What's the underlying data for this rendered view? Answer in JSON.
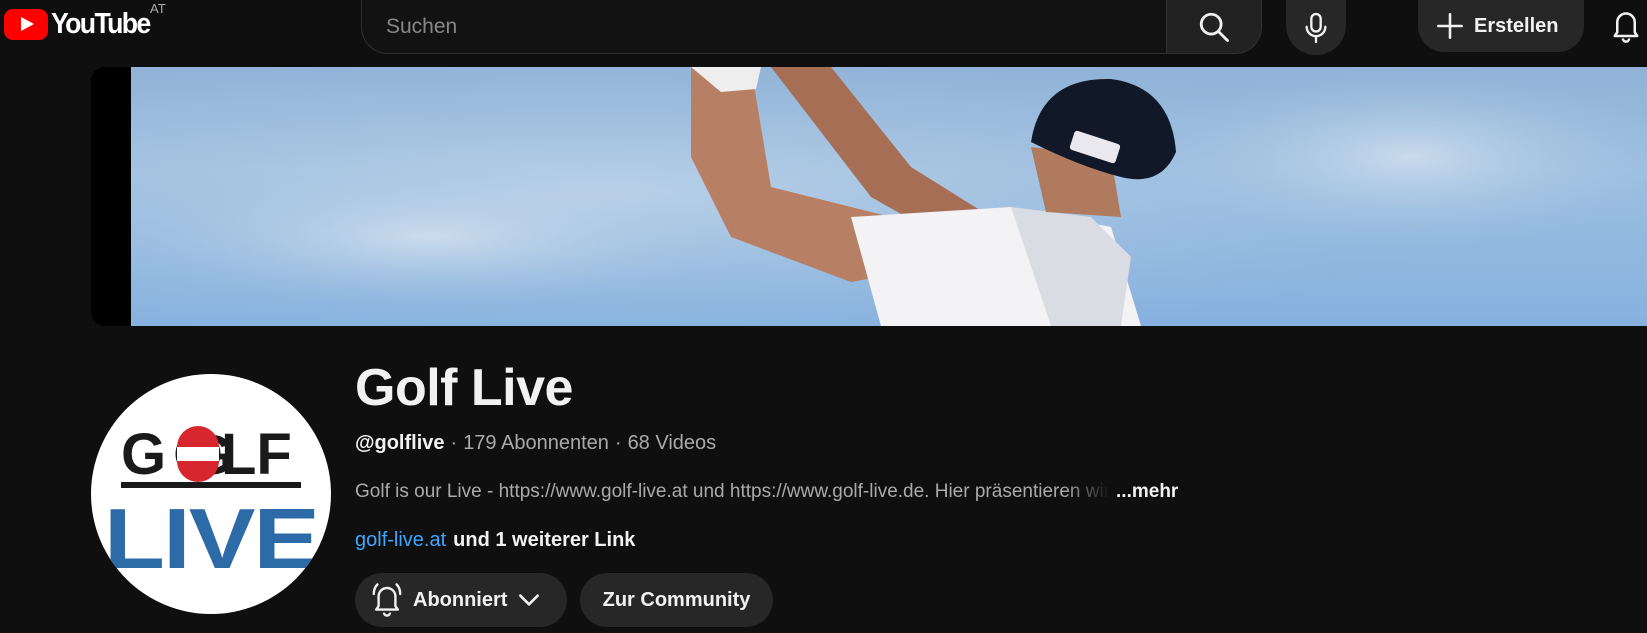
{
  "header": {
    "logo_text": "YouTube",
    "country_code": "AT",
    "search_placeholder": "Suchen",
    "create_label": "Erstellen"
  },
  "channel": {
    "name": "Golf Live",
    "handle": "@golflive",
    "separator": "·",
    "subscribers": "179 Abonnenten",
    "videos": "68 Videos",
    "description": "Golf is our Live - https://www.golf-live.at und https://www.golf-live.de. Hier präsentieren wir",
    "more_label": "...mehr",
    "link": "golf-live.at",
    "more_links": "und 1 weiterer Link",
    "avatar_logo_top": "GOLF",
    "avatar_logo_bottom": "LIVE"
  },
  "actions": {
    "subscribed_label": "Abonniert",
    "community_label": "Zur Community"
  },
  "icons": {
    "search": "search-icon",
    "mic": "mic-icon",
    "create": "plus-icon",
    "notifications": "bell-icon",
    "subscribed_bell": "bell-ringing-icon",
    "dropdown": "chevron-down-icon"
  },
  "colors": {
    "background": "#0f0f0f",
    "brand_red": "#ff0000",
    "link_blue": "#3ea6ff",
    "button_bg": "#272727",
    "avatar_blue": "#2c6aa8"
  }
}
